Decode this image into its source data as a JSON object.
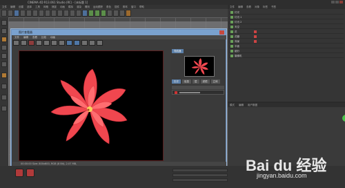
{
  "window": {
    "title": "CINEMA 4D R13.061 Studio (RC) - [未标题 1]"
  },
  "menubar": {
    "items": [
      "文件",
      "编辑",
      "创建",
      "选择",
      "工具",
      "网格",
      "捕捉",
      "动画",
      "模拟",
      "渲染",
      "雕刻",
      "运动跟踪",
      "角色",
      "插件",
      "脚本",
      "窗口",
      "帮助"
    ]
  },
  "object_manager": {
    "menu": [
      "文件",
      "编辑",
      "查看",
      "对象",
      "标签",
      "书签"
    ],
    "rows": [
      "灯光",
      "灯光.1",
      "灯光.2",
      "天空",
      "花",
      "花瓣",
      "背景",
      "平面",
      "细分",
      "摄像机"
    ]
  },
  "attribute_manager": {
    "menu": [
      "模式",
      "编辑",
      "用户数据"
    ]
  },
  "picture_viewer": {
    "title": "图片查看器",
    "menu": [
      "文件",
      "编辑",
      "查看",
      "比较",
      "动画"
    ],
    "tab_navigator": "导航器",
    "tabs": [
      "历史",
      "信息",
      "层",
      "滤镜",
      "立体"
    ],
    "status": "00:00:00  Size: 800x600, RGB (8 Bit), 2.07 MB,"
  },
  "colors": {
    "accent": "#7aa2cf",
    "flower": "#f0474f",
    "background": "#3b3b3b"
  },
  "watermark": {
    "logo_text": "Bai du 经验",
    "url": "jingyan.baidu.com"
  }
}
